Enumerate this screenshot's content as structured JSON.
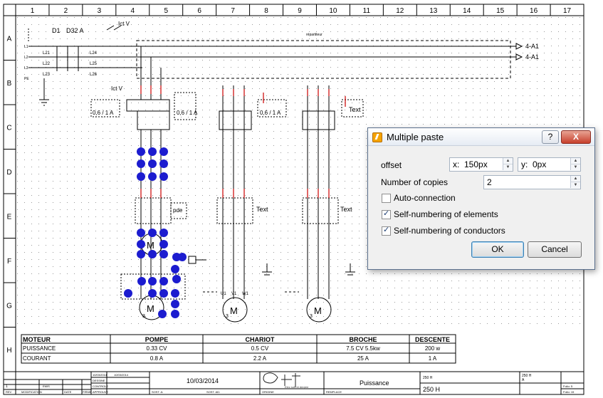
{
  "schematic": {
    "columns": [
      "1",
      "2",
      "3",
      "4",
      "5",
      "6",
      "7",
      "8",
      "9",
      "10",
      "11",
      "12",
      "13",
      "14",
      "15",
      "16",
      "17"
    ],
    "rows": [
      "A",
      "B",
      "C",
      "D",
      "E",
      "F",
      "G",
      "H"
    ],
    "labels": {
      "d1": "D1",
      "d32": "D32 A",
      "contactor": "Ict V",
      "ict": "Ict V",
      "repartiteur": "répartiteur",
      "arrow1": "4-A1",
      "arrow2": "4-A1",
      "l1": "L1",
      "l2": "L2",
      "l3": "L3",
      "pe": "PE",
      "l21": "L21",
      "l22": "L22",
      "l23": "L23",
      "l24": "L24",
      "l25": "L25",
      "l26": "L26",
      "range1": "0,6 / 1 A",
      "range2": "0,6 / 1 A",
      "range3": "0,6 / 1 A",
      "text1": "Text",
      "text2": "Text",
      "text3": "Text",
      "pde": "pde",
      "u1": "U1",
      "v1": "V1",
      "w1": "W1",
      "motor": "M",
      "motor_sub": "3"
    },
    "table": {
      "headers": [
        "MOTEUR",
        "POMPE",
        "CHARIOT",
        "BROCHE",
        "DESCENTE"
      ],
      "rows": [
        [
          "PUISSANCE",
          "0.33 CV",
          "0.5 CV",
          "7.5 CV 5.5kw",
          "200 w"
        ],
        [
          "COURANT",
          "0.8 A",
          "2.2 A",
          "25 A",
          "1 A"
        ]
      ]
    },
    "cartouche": {
      "date": "10/03/2014",
      "date_small1": "10/03/2014",
      "date_small2": "10/03/2014",
      "dessine": "DESSINE",
      "controle": "CONTROLE",
      "approuve": "APPROUVE",
      "rev": "REV",
      "modification": "MODIFICATION",
      "date_col": "DATE",
      "emis": "EMIS",
      "firme": "FIRME",
      "rev_num": "1",
      "logo_text": "Qet",
      "logo_sub": "Elec soft et degree",
      "section": "Puissance",
      "ref1": "250 H",
      "ref2": "250 H",
      "ref_small": "250 H",
      "ref_small2": "A",
      "folio1": "Folio: 5",
      "folio2": "Folio: 15",
      "origine": "ORIGINE",
      "remplace": "REMPLACE",
      "sost_a": "SOST. A:",
      "sost_ad": "SOST. AD:"
    }
  },
  "dialog": {
    "title": "Multiple paste",
    "help": "?",
    "close": "X",
    "offset_label": "offset",
    "x_prefix": "x:",
    "x_value": "150px",
    "y_prefix": "y:",
    "y_value": "0px",
    "copies_label": "Number of copies",
    "copies_value": "2",
    "auto_connection": {
      "label": "Auto-connection",
      "checked": false
    },
    "self_numbering_elements": {
      "label": "Self-numbering of elements",
      "checked": true
    },
    "self_numbering_conductors": {
      "label": "Self-numbering of conductors",
      "checked": true
    },
    "ok": "OK",
    "cancel": "Cancel"
  },
  "colors": {
    "selection": "#1c1ccf",
    "wire": "#000000",
    "wire_red": "#cc0000",
    "grid_dot": "#9a9a9a"
  }
}
